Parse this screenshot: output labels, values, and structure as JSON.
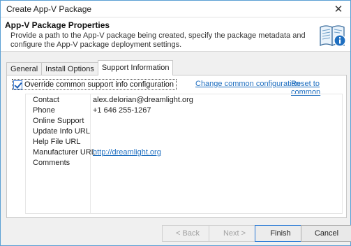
{
  "window": {
    "title": "Create App-V Package",
    "close_glyph": "✕"
  },
  "header": {
    "title": "App-V Package Properties",
    "description": "Provide a path to the App-V package being created, specify the package metadata and configure the App-V package deployment settings.",
    "icon": "book-info-icon"
  },
  "tabs": [
    {
      "label": "General"
    },
    {
      "label": "Install Options"
    },
    {
      "label": "Support Information"
    }
  ],
  "support": {
    "override_label": "Override common support info configuration",
    "override_checked": true,
    "change_link": "Change common configuration",
    "reset_link": "Reset to common",
    "rows": [
      {
        "key": "Contact",
        "value": "alex.delorian@dreamlight.org"
      },
      {
        "key": "Phone",
        "value": "+1 646 255-1267"
      },
      {
        "key": "Online Support",
        "value": ""
      },
      {
        "key": "Update Info URL",
        "value": ""
      },
      {
        "key": "Help File URL",
        "value": ""
      },
      {
        "key": "Manufacturer URL",
        "value": "http://dreamlight.org"
      },
      {
        "key": "Comments",
        "value": ""
      }
    ]
  },
  "footer": {
    "back_label": "< Back",
    "next_label": "Next >",
    "finish_label": "Finish",
    "cancel_label": "Cancel"
  },
  "colors": {
    "accent": "#1f6fc0",
    "window_border": "#5a9fd4"
  }
}
